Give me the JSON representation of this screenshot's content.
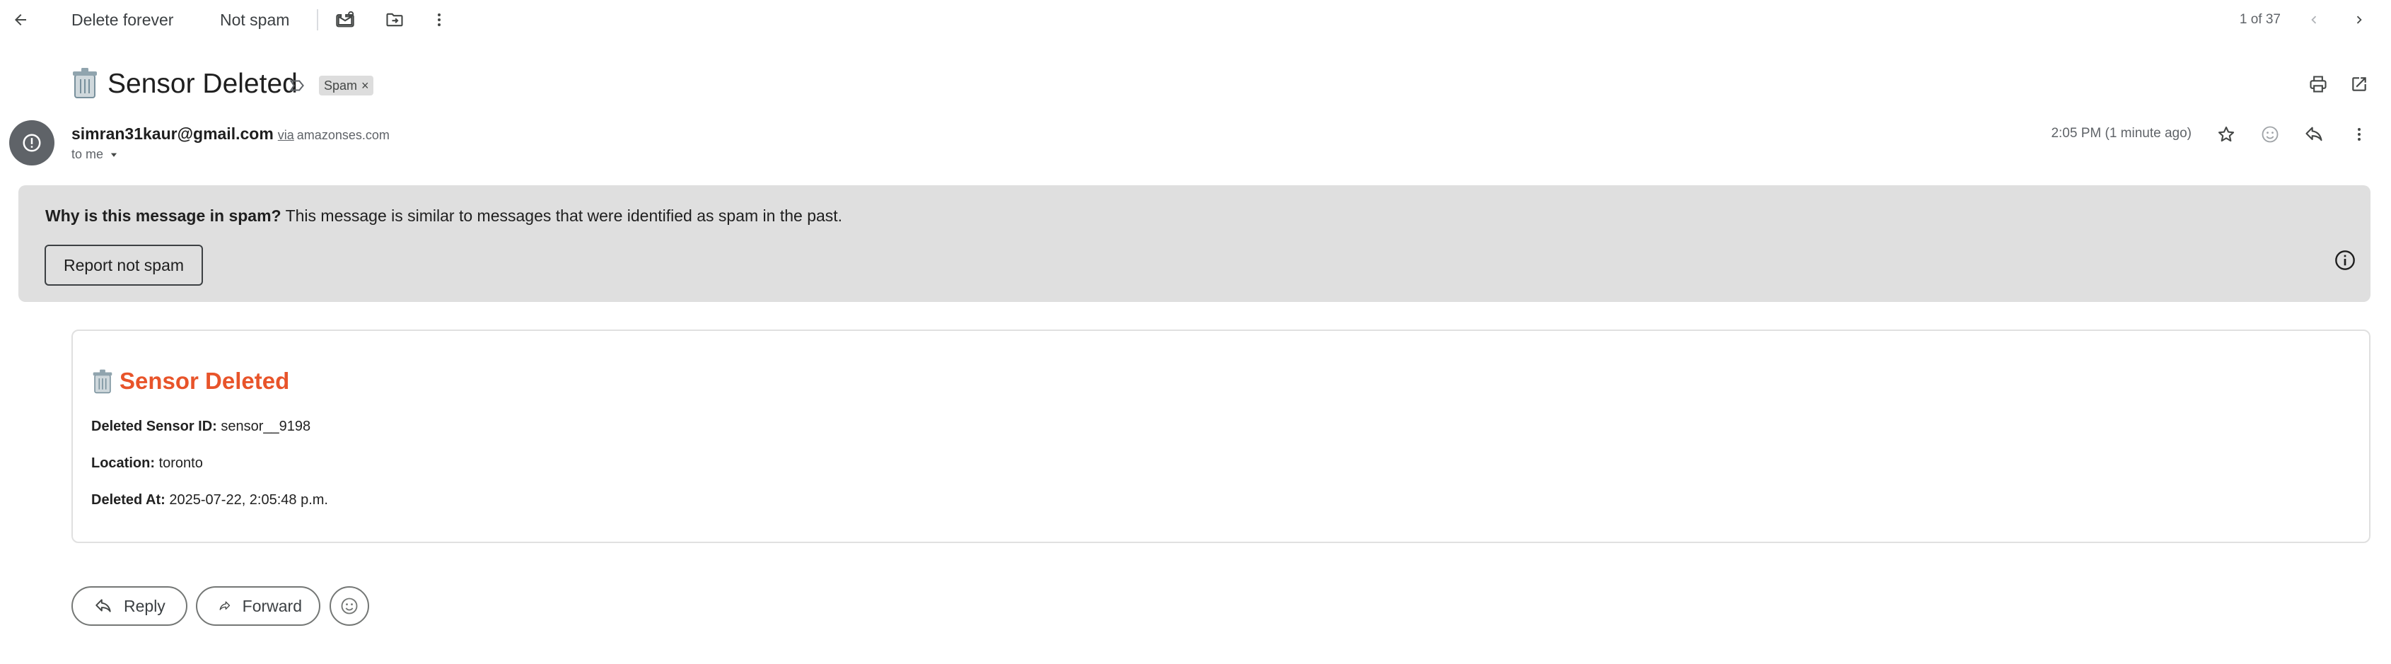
{
  "toolbar": {
    "delete_forever_label": "Delete forever",
    "not_spam_label": "Not spam",
    "pager_text": "1 of 37"
  },
  "subject": {
    "emoji": "🗑️",
    "text": "Sensor Deleted",
    "label_chip": "Spam",
    "label_chip_remove": "×"
  },
  "sender": {
    "email": "simran31kaur@gmail.com",
    "via_label": "via",
    "via_domain": "amazonses.com",
    "recipient": "to me",
    "timestamp": "2:05 PM (1 minute ago)"
  },
  "spam_banner": {
    "question": "Why is this message in spam?",
    "explanation": "This message is similar to messages that were identified as spam in the past.",
    "report_button_label": "Report not spam"
  },
  "message_body": {
    "title_emoji": "🗑️",
    "title": "Sensor Deleted",
    "fields": [
      {
        "label": "Deleted Sensor ID:",
        "value": "sensor__9198"
      },
      {
        "label": "Location:",
        "value": "toronto"
      },
      {
        "label": "Deleted At:",
        "value": "2025-07-22, 2:05:48 p.m."
      }
    ]
  },
  "actions": {
    "reply_label": "Reply",
    "forward_label": "Forward"
  },
  "colors": {
    "accent_title": "#e8542a",
    "banner_bg": "#dfdfdf",
    "avatar_bg": "#5f6368"
  },
  "icons": {
    "back": "arrow-left-icon",
    "mark_unread": "mail-mark-icon",
    "move_to": "folder-move-icon",
    "more": "more-vert-icon",
    "prev": "chevron-left-icon",
    "next": "chevron-right-icon",
    "important": "important-marker-icon",
    "print": "print-icon",
    "new_window": "open-in-new-icon",
    "avatar": "alert-circle-icon",
    "star": "star-icon",
    "emoji": "emoji-reaction-icon",
    "reply": "reply-icon",
    "info": "info-icon",
    "forward": "forward-icon",
    "trash_emoji": "wastebasket-icon"
  }
}
